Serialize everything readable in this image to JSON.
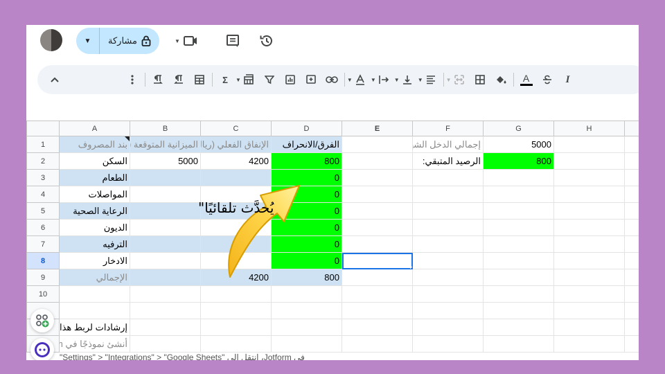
{
  "topbar": {
    "share_label": "مشاركة"
  },
  "grid": {
    "columns": [
      "A",
      "B",
      "C",
      "D",
      "E",
      "F",
      "G",
      "H"
    ],
    "selected_column": "E",
    "selected_row": "8",
    "rows": [
      {
        "n": "1",
        "a": "بند المصروف",
        "b": "الميزانية المتوقعة (ريال)",
        "c": "الإنفاق الفعلي (ريال)",
        "d": "الفرق/الانحراف",
        "e": "",
        "f": "إجمالي الدخل الشهري الصافي:",
        "g": "5000",
        "h": ""
      },
      {
        "n": "2",
        "a": "السكن",
        "b": "5000",
        "c": "4200",
        "d": "800",
        "e": "",
        "f": "الرصيد المتبقي:",
        "g": "800",
        "h": ""
      },
      {
        "n": "3",
        "a": "الطعام",
        "b": "",
        "c": "",
        "d": "0",
        "e": "",
        "f": "",
        "g": "",
        "h": ""
      },
      {
        "n": "4",
        "a": "المواصلات",
        "b": "",
        "c": "",
        "d": "0",
        "e": "",
        "f": "",
        "g": "",
        "h": ""
      },
      {
        "n": "5",
        "a": "الرعاية الصحية",
        "b": "",
        "c": "",
        "d": "0",
        "e": "",
        "f": "",
        "g": "",
        "h": ""
      },
      {
        "n": "6",
        "a": "الديون",
        "b": "",
        "c": "",
        "d": "0",
        "e": "",
        "f": "",
        "g": "",
        "h": ""
      },
      {
        "n": "7",
        "a": "الترفيه",
        "b": "",
        "c": "",
        "d": "0",
        "e": "",
        "f": "",
        "g": "",
        "h": ""
      },
      {
        "n": "8",
        "a": "الادخار",
        "b": "",
        "c": "",
        "d": "0",
        "e": "",
        "f": "",
        "g": "",
        "h": ""
      },
      {
        "n": "9",
        "a": "الإجمالي",
        "b": "",
        "c": "4200",
        "d": "800",
        "e": "",
        "f": "",
        "g": "",
        "h": ""
      },
      {
        "n": "10",
        "a": "",
        "b": "",
        "c": "",
        "d": "",
        "e": "",
        "f": "",
        "g": "",
        "h": ""
      }
    ]
  },
  "instructions": {
    "line1": "إرشادات لربط هذا",
    "line2": "أنشئ نموذجًا في Jotform",
    "line3": "في Jotform، انتقل إلى \"Settings\" > \"Integrations\" > \"Google Sheets\""
  },
  "annotation": {
    "text": "يُحدَّث تلقائيًا\""
  },
  "colors": {
    "background": "#ba85c6",
    "highlight_green": "#00ff00",
    "row_blue": "#cfe2f3",
    "share_button": "#c2e7ff",
    "selection": "#1a73e8"
  }
}
